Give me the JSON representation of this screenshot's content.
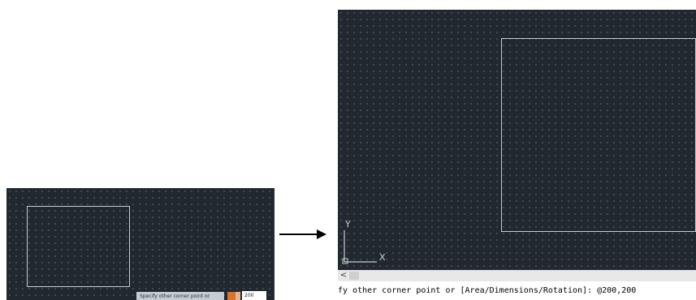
{
  "left_view": {
    "tooltip": "Specify other corner point or",
    "input_value": "200"
  },
  "right_view": {
    "ucs_y_label": "Y",
    "ucs_x_label": "X"
  },
  "scrollbar": {
    "left_arrow": "<"
  },
  "command_line": {
    "text": "fy other corner point or [Area/Dimensions/Rotation]: @200,200"
  },
  "colors": {
    "canvas": "#212830",
    "grid_dot": "#6d7580",
    "rectangle": "#c9ced6",
    "accent_swatch": "#d8742e"
  }
}
